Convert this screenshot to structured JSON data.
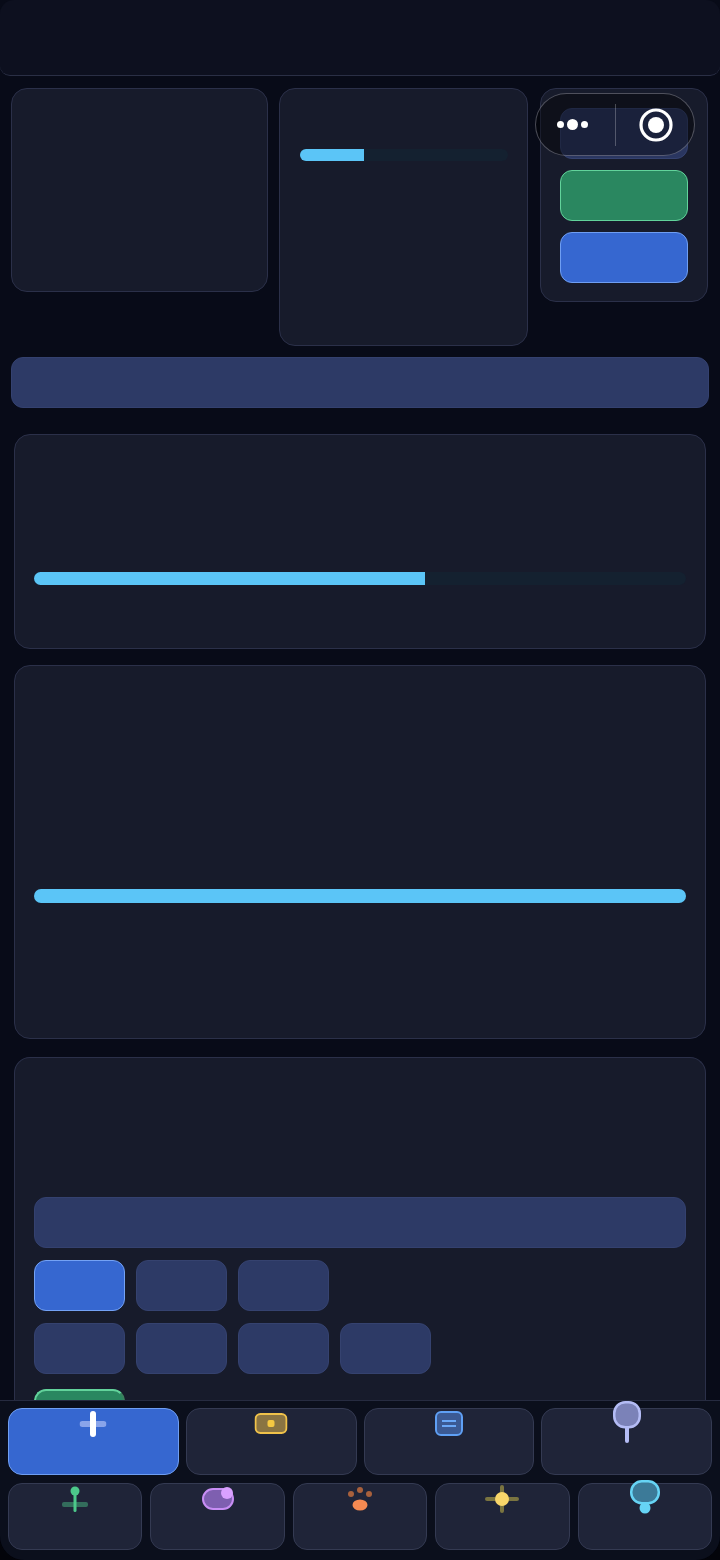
{
  "stats_row": {
    "progress_card": {
      "level": 0.31
    },
    "button_panel": {
      "buttons": [
        {
          "kind": "neutral"
        },
        {
          "kind": "success"
        },
        {
          "kind": "primary"
        }
      ]
    }
  },
  "progress_cards": [
    {
      "level": 0.6
    },
    {
      "level": 1
    }
  ],
  "chip_card": {
    "chip_rows": [
      {
        "chips": [
          {
            "selected": true
          },
          {
            "selected": false
          },
          {
            "selected": false
          }
        ]
      },
      {
        "chips": [
          {
            "selected": false
          },
          {
            "selected": false
          },
          {
            "selected": false
          },
          {
            "selected": false
          }
        ]
      }
    ],
    "buttons": [
      {
        "kind": "success"
      }
    ]
  },
  "tab_bar": {
    "rows": [
      {
        "tabs": [
          {
            "selected": true
          },
          {
            "selected": false
          },
          {
            "selected": false
          },
          {
            "selected": false
          }
        ]
      },
      {
        "tabs": [
          {
            "selected": false
          },
          {
            "selected": false
          },
          {
            "selected": false
          },
          {
            "selected": false
          },
          {
            "selected": false
          }
        ]
      }
    ]
  }
}
